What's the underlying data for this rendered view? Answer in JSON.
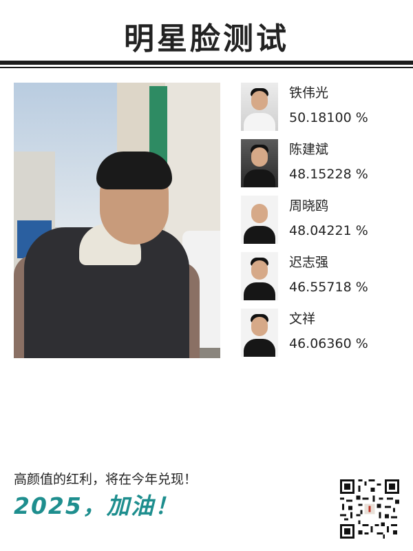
{
  "header": {
    "title": "明星脸测试"
  },
  "main_photo": {
    "icon": "uploaded-face-photo"
  },
  "matches": [
    {
      "name": "铁伟光",
      "score": "50.18100 %",
      "percent": 50.181,
      "avatar": "celebrity-photo-1"
    },
    {
      "name": "陈建斌",
      "score": "48.15228 %",
      "percent": 48.15228,
      "avatar": "celebrity-photo-2"
    },
    {
      "name": "周晓鸥",
      "score": "48.04221 %",
      "percent": 48.04221,
      "avatar": "celebrity-photo-3"
    },
    {
      "name": "迟志强",
      "score": "46.55718 %",
      "percent": 46.55718,
      "avatar": "celebrity-photo-4"
    },
    {
      "name": "文祥",
      "score": "46.06360 %",
      "percent": 46.0636,
      "avatar": "celebrity-photo-5"
    }
  ],
  "footer": {
    "slogan": "高颜值的红利，将在今年兑现！",
    "motto": "2025，加油！",
    "qr_icon": "qr-code",
    "accent_color": "#1e8e8e"
  }
}
